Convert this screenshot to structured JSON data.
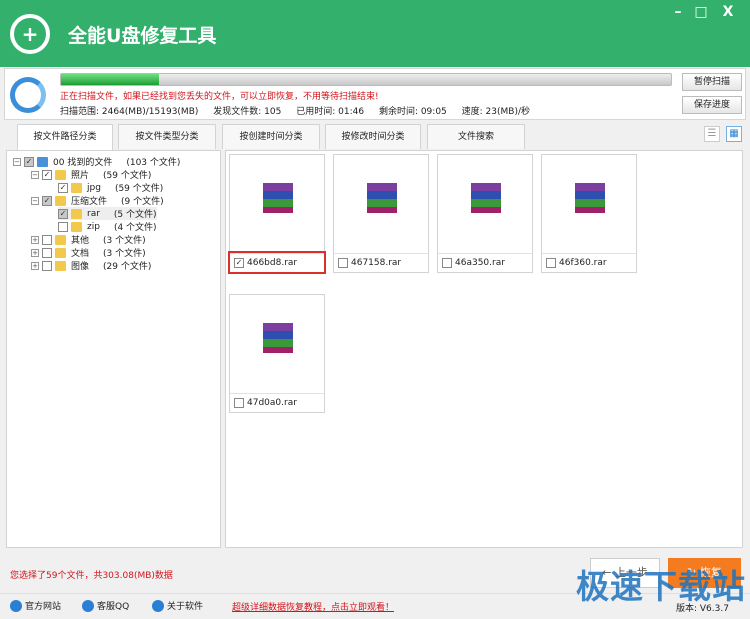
{
  "app": {
    "title": "全能U盘修复工具",
    "minimize": "–",
    "maximize": "□",
    "close": "X"
  },
  "scan": {
    "progress_percent": 16,
    "message": "正在扫描文件，如果已经找到您丢失的文件，可以立即恢复，不用等待扫描结束!",
    "range": "扫描范围: 2464(MB)/15193(MB)",
    "found": "发现文件数: 105",
    "elapsed": "已用时间: 01:46",
    "remaining": "剩余时间: 09:05",
    "speed": "速度: 23(MB)/秒",
    "pause_label": "暂停扫描",
    "save_label": "保存进度"
  },
  "tabs": [
    {
      "label": "按文件路径分类"
    },
    {
      "label": "按文件类型分类"
    },
    {
      "label": "按创建时间分类"
    },
    {
      "label": "按修改时间分类"
    },
    {
      "label": "文件搜索"
    }
  ],
  "view": {
    "list_icon": "☰",
    "grid_icon": "▦"
  },
  "tree": [
    {
      "label": "00 找到的文件",
      "count": "(103 个文件)"
    },
    {
      "label": "照片",
      "count": "(59 个文件)"
    },
    {
      "label": "jpg",
      "count": "(59 个文件)"
    },
    {
      "label": "压缩文件",
      "count": "(9 个文件)"
    },
    {
      "label": "rar",
      "count": "(5 个文件)"
    },
    {
      "label": "zip",
      "count": "(4 个文件)"
    },
    {
      "label": "其他",
      "count": "(3 个文件)"
    },
    {
      "label": "文档",
      "count": "(3 个文件)"
    },
    {
      "label": "图像",
      "count": "(29 个文件)"
    }
  ],
  "files": [
    {
      "name": "466bd8.rar",
      "checked": true
    },
    {
      "name": "467158.rar",
      "checked": false
    },
    {
      "name": "46a350.rar",
      "checked": false
    },
    {
      "name": "46f360.rar",
      "checked": false
    },
    {
      "name": "47d0a0.rar",
      "checked": false
    }
  ],
  "status": {
    "selection": "您选择了59个文件，共303.08(MB)数据",
    "prev_label": "← 上一步",
    "recover_label": "↻ 恢复"
  },
  "footer": {
    "website": "官方网站",
    "qq": "客服QQ",
    "about": "关于软件",
    "tutorial": "超级详细数据恢复教程，点击立即观看！",
    "version": "版本: V6.3.7",
    "watermark": "极速下载站"
  }
}
